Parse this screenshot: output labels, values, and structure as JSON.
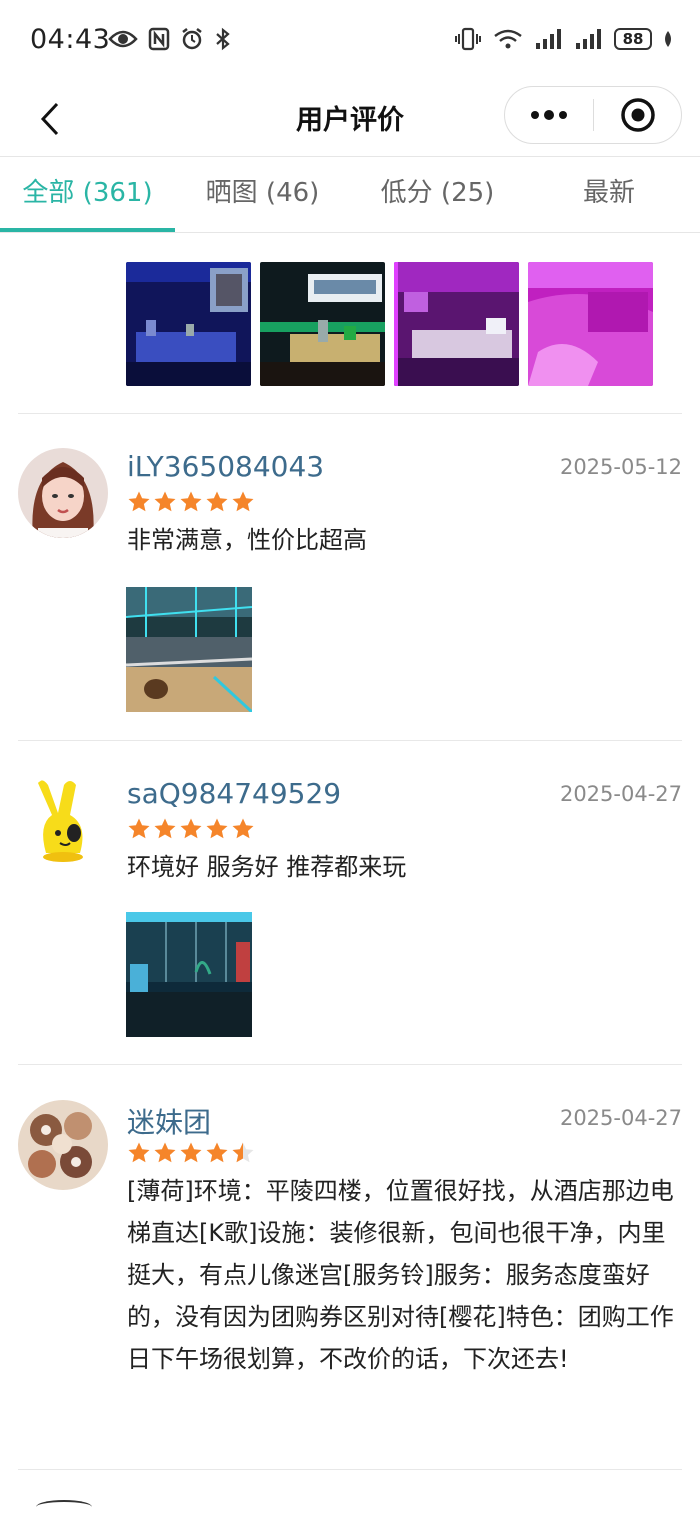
{
  "status": {
    "time": "04:43",
    "battery": "88",
    "signal_tag": "6"
  },
  "header": {
    "title": "用户评价"
  },
  "tabs": [
    {
      "label": "全部 (361)",
      "active": true
    },
    {
      "label": "晒图 (46)",
      "active": false
    },
    {
      "label": "低分 (25)",
      "active": false
    },
    {
      "label": "最新",
      "active": false
    }
  ],
  "colors": {
    "accent": "#2ab5a5",
    "username": "#3d6b8c",
    "star": "#f5852a"
  },
  "reviews": [
    {
      "user": "iLY365084043",
      "date": "2025-05-12",
      "rating": 5,
      "text": "非常满意，性价比超高"
    },
    {
      "user": "saQ984749529",
      "date": "2025-04-27",
      "rating": 5,
      "text": "环境好 服务好 推荐都来玩"
    },
    {
      "user": "迷妹团",
      "date": "2025-04-27",
      "rating": 4.5,
      "text": "[薄荷]环境：平陵四楼，位置很好找，从酒店那边电梯直达[K歌]设施：装修很新，包间也很干净，内里挺大，有点儿像迷宫[服务铃]服务：服务态度蛮好的，没有因为团购券区别对待[樱花]特色：团购工作日下午场很划算，不改价的话，下次还去!"
    }
  ]
}
